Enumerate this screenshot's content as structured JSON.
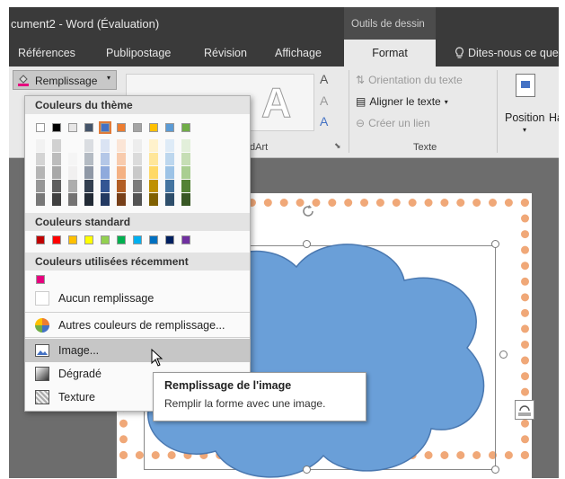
{
  "title_bar": {
    "title": "cument2 - Word (Évaluation)",
    "tools_context": "Outils de dessin"
  },
  "ribbon_tabs": [
    {
      "label": "Références"
    },
    {
      "label": "Publipostage"
    },
    {
      "label": "Révision"
    },
    {
      "label": "Affichage"
    },
    {
      "label": "Format"
    },
    {
      "label": "Dites-nous ce que"
    }
  ],
  "ribbon": {
    "remplissage": "Remplissage",
    "wordart_group": "dArt",
    "texte_group": "Texte",
    "orientation": "Orientation du texte",
    "aligner": "Aligner le texte",
    "lien": "Créer un lien",
    "position": "Position",
    "ha": "Ha",
    "letter_a": "A",
    "letter_a2": "A",
    "letter_a3": "A",
    "wordart_big": "A"
  },
  "dropdown": {
    "theme_colors_title": "Couleurs du thème",
    "standard_colors_title": "Couleurs standard",
    "recent_colors_title": "Couleurs utilisées récemment",
    "theme_row": [
      "#ffffff",
      "#000000",
      "#e7e6e6",
      "#44546a",
      "#4472c4",
      "#ed7d31",
      "#a5a5a5",
      "#ffc000",
      "#5b9bd5",
      "#70ad47"
    ],
    "standard_row": [
      "#c00000",
      "#ff0000",
      "#ffc000",
      "#ffff00",
      "#92d050",
      "#00b050",
      "#00b0f0",
      "#0070c0",
      "#002060",
      "#7030a0"
    ],
    "recent_row": [
      "#e6007e"
    ],
    "items": [
      {
        "label": "Aucun remplissage"
      },
      {
        "label": "Autres couleurs de remplissage..."
      },
      {
        "label": "Image..."
      },
      {
        "label": "Dégradé"
      },
      {
        "label": "Texture"
      }
    ]
  },
  "tooltip": {
    "title": "Remplissage de l'image",
    "description": "Remplir la forme avec une image."
  },
  "colors": {
    "cloud_fill": "#6a9fd8",
    "border_deco": "#f0a878"
  }
}
